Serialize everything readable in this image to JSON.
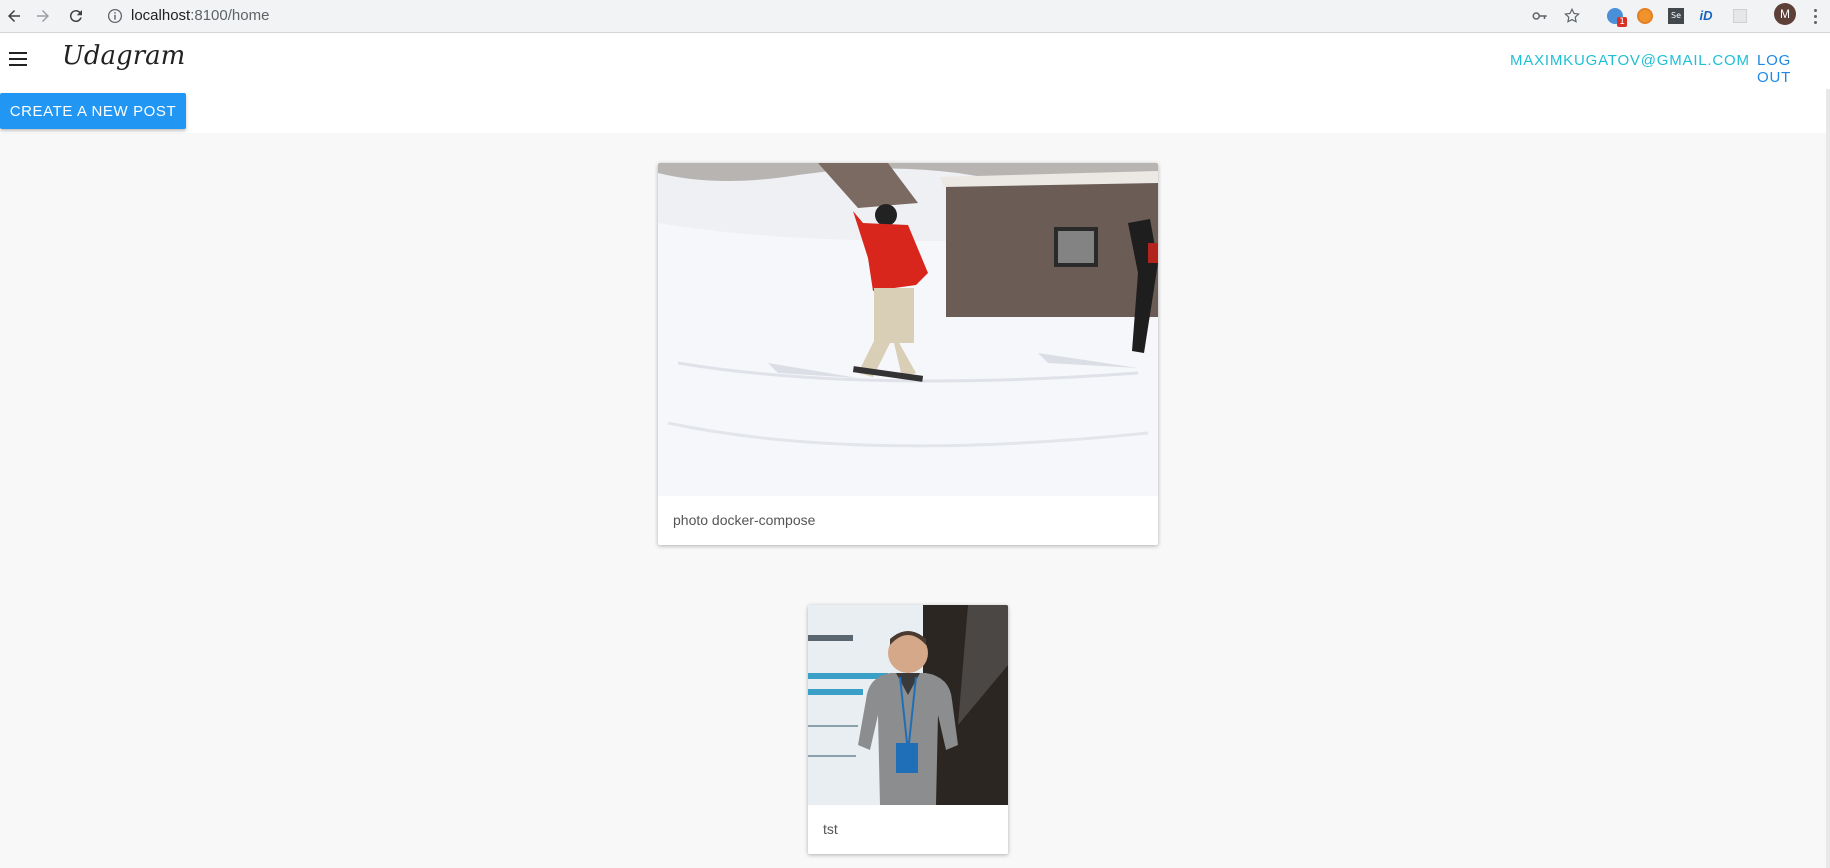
{
  "browser": {
    "url_host": "localhost",
    "url_path": ":8100/home",
    "extension_badge": "1",
    "profile_initial": "M"
  },
  "header": {
    "title": "Udagram",
    "email": "MAXIMKUGATOV@GMAIL.COM",
    "logout": "LOG OUT"
  },
  "actions": {
    "create_post": "CREATE A NEW POST"
  },
  "feed": {
    "posts": [
      {
        "caption": "photo docker-compose",
        "image": "snowboarder-on-slope-photo"
      },
      {
        "caption": "tst",
        "image": "man-at-conference-photo"
      }
    ]
  },
  "colors": {
    "accent": "#2196f3",
    "email_color": "#1fbfd6",
    "logout_color": "#1e88e5"
  }
}
